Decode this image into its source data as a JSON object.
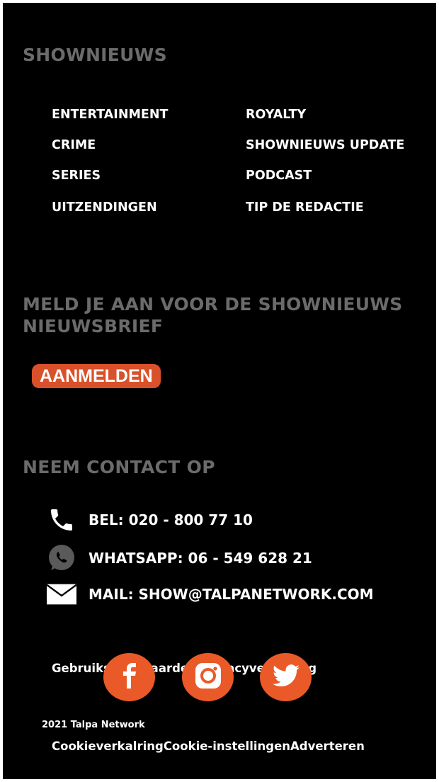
{
  "sections": {
    "shownieuws_title": "SHOWNIEUWS",
    "newsletter_title": "MELD JE AAN VOOR DE SHOWNIEUWS NIEUWSBRIEF",
    "contact_title": "NEEM CONTACT OP"
  },
  "nav": {
    "left": [
      "ENTERTAINMENT",
      "CRIME",
      "SERIES",
      "UITZENDINGEN"
    ],
    "right": [
      "ROYALTY",
      "SHOWNIEUWS UPDATE",
      "PODCAST",
      "TIP DE REDACTIE"
    ]
  },
  "newsletter": {
    "button_label": "AANMELDEN"
  },
  "contact": {
    "phone": "BEL: 020 - 800 77 10",
    "whatsapp": "WHATSAPP: 06 - 549 628 21",
    "mail": "MAIL: SHOW@TALPANETWORK.COM",
    "icons": [
      "phone-icon",
      "whatsapp-icon",
      "mail-icon"
    ]
  },
  "footer": {
    "partial_links_text": "Gebruiksvoorwaarden Privacyverklaring",
    "copyright": "2021 Talpa Network",
    "links": [
      "Cookieverkalring",
      "Cookie-instellingen",
      "Adverteren"
    ]
  },
  "social": [
    "facebook-icon",
    "instagram-icon",
    "twitter-icon"
  ],
  "colors": {
    "background": "#000000",
    "heading": "#6b6b6b",
    "accent": "#d9512a",
    "social": "#ea5a28"
  }
}
